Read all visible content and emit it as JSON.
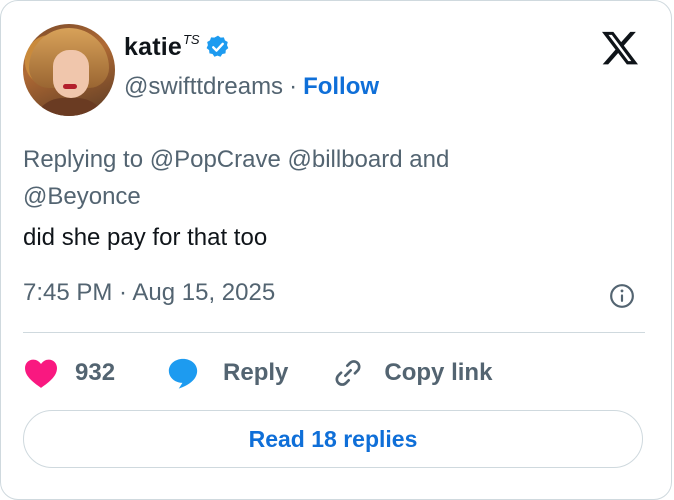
{
  "author": {
    "display_name": "katie",
    "name_suffix": "TS",
    "handle": "@swifttdreams",
    "separator": "·",
    "follow_label": "Follow",
    "verified_color": "#1d9bf0"
  },
  "reply_context": {
    "text": "Replying to @PopCrave @billboard and @Beyonce"
  },
  "tweet": {
    "text": "did she pay for that too",
    "timestamp": "7:45 PM · Aug 15, 2025"
  },
  "actions": {
    "like_count": "932",
    "reply_label": "Reply",
    "copy_link_label": "Copy link",
    "like_color": "#f91880",
    "reply_color": "#1d9bf0"
  },
  "read_replies_label": "Read 18 replies",
  "icons": [
    "x-logo-icon",
    "verified-badge-icon",
    "info-icon",
    "heart-icon",
    "reply-bubble-icon",
    "link-icon"
  ]
}
